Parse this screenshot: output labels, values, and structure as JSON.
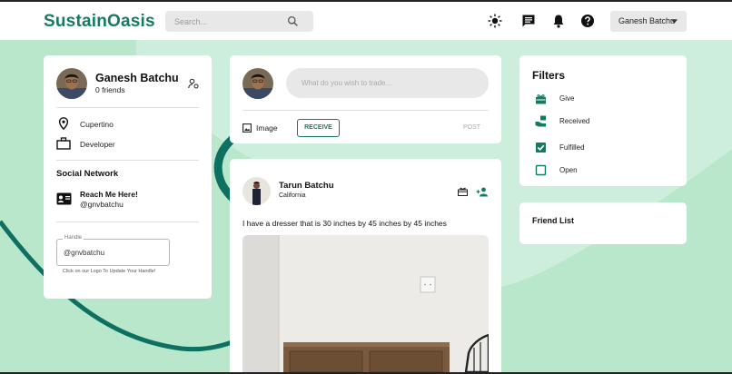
{
  "app": {
    "logo": "SustainOasis"
  },
  "search": {
    "placeholder": "Search..."
  },
  "user_menu": {
    "label": "Ganesh Batchu"
  },
  "profile": {
    "name": "Ganesh Batchu",
    "friends": "0 friends",
    "location": "Cupertino",
    "occupation": "Developer",
    "social_title": "Social Network",
    "reach_title": "Reach Me Here!",
    "reach_handle": "@gnvbatchu",
    "handle_legend": "Handle",
    "handle_value": "@gnvbatchu",
    "handle_hint": "Click on our Logo To Update Your Handle!"
  },
  "composer": {
    "placeholder": "What do you wish to trade...",
    "image_label": "Image",
    "receive_label": "RECEIVE",
    "post_label": "POST"
  },
  "post": {
    "author": "Tarun Batchu",
    "location": "California",
    "text": "I have a dresser that is 30 inches by 45 inches by 45 inches"
  },
  "filters": {
    "title": "Filters",
    "items": [
      {
        "label": "Give",
        "icon": "gift-icon",
        "checked": false
      },
      {
        "label": "Received",
        "icon": "received-hand-icon",
        "checked": false
      },
      {
        "label": "Fulfilled",
        "icon": "checkbox-checked-icon",
        "checked": true
      },
      {
        "label": "Open",
        "icon": "checkbox-empty-icon",
        "checked": false
      }
    ]
  },
  "friend_list": {
    "title": "Friend List"
  },
  "colors": {
    "brand": "#167a62",
    "background": "#cdeedd",
    "accent_dark": "#0e7060"
  }
}
